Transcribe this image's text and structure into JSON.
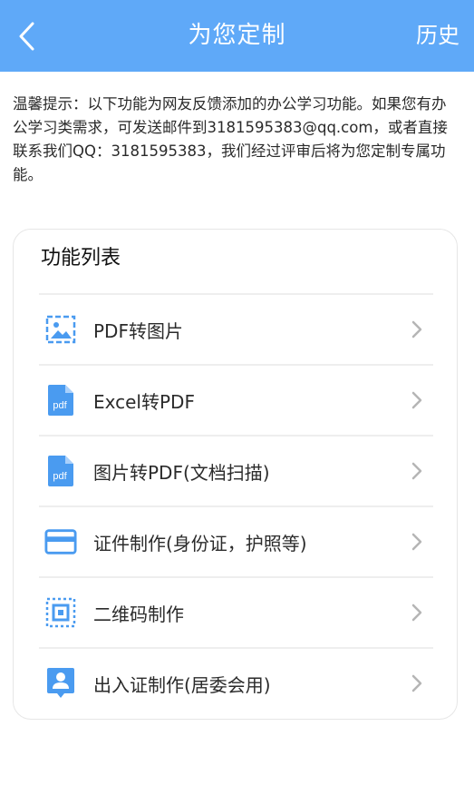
{
  "header": {
    "title": "为您定制",
    "history_label": "历史",
    "background_color": "#5fa9f8"
  },
  "notice": {
    "text": "温馨提示：以下功能为网友反馈添加的办公学习功能。如果您有办公学习类需求，可发送邮件到3181595383@qq.com，或者直接联系我们QQ：3181595383，我们经过评审后将为您定制专属功能。"
  },
  "card": {
    "title": "功能列表",
    "items": [
      {
        "label": "PDF转图片",
        "icon": "image-icon"
      },
      {
        "label": "Excel转PDF",
        "icon": "pdf-file-icon"
      },
      {
        "label": "图片转PDF(文档扫描)",
        "icon": "pdf-file-icon"
      },
      {
        "label": "证件制作(身份证，护照等)",
        "icon": "card-icon"
      },
      {
        "label": "二维码制作",
        "icon": "qr-scan-icon"
      },
      {
        "label": "出入证制作(居委会用)",
        "icon": "badge-person-icon"
      }
    ]
  },
  "colors": {
    "accent": "#5fa9f8",
    "icon": "#4a9bf0"
  }
}
